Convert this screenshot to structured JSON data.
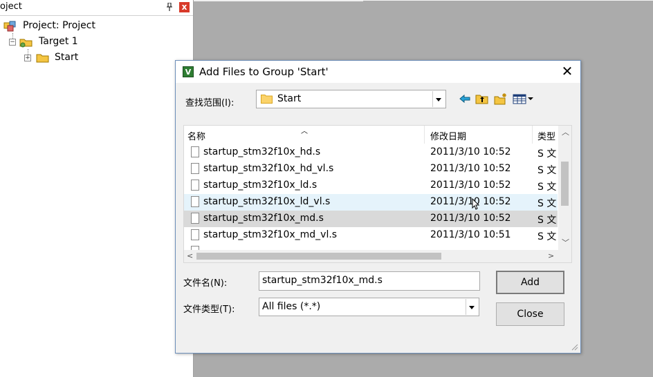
{
  "project_pane": {
    "header_title": "oject",
    "pin": "❘",
    "close": "x",
    "tree": [
      {
        "label": "Project: Project"
      },
      {
        "label": "Target 1"
      },
      {
        "label": "Start"
      }
    ]
  },
  "dialog": {
    "app_icon_letter": "V",
    "title": "Add Files to Group 'Start'",
    "close": "✕",
    "lookin_label": "查找范围(I):",
    "lookin_value": "Start",
    "columns": {
      "name": "名称",
      "date": "修改日期",
      "type": "类型"
    },
    "files": [
      {
        "name": "startup_stm32f10x_hd.s",
        "date": "2011/3/10 10:52",
        "type": "S 文"
      },
      {
        "name": "startup_stm32f10x_hd_vl.s",
        "date": "2011/3/10 10:52",
        "type": "S 文"
      },
      {
        "name": "startup_stm32f10x_ld.s",
        "date": "2011/3/10 10:52",
        "type": "S 文"
      },
      {
        "name": "startup_stm32f10x_ld_vl.s",
        "date": "2011/3/10 10:52",
        "type": "S 文"
      },
      {
        "name": "startup_stm32f10x_md.s",
        "date": "2011/3/10 10:52",
        "type": "S 文"
      },
      {
        "name": "startup_stm32f10x_md_vl.s",
        "date": "2011/3/10 10:51",
        "type": "S 文"
      }
    ],
    "filename_label": "文件名(N):",
    "filename_value": "startup_stm32f10x_md.s",
    "filetype_label": "文件类型(T):",
    "filetype_value": "All files (*.*)",
    "add_label": "Add",
    "close_label": "Close"
  },
  "colors": {
    "selected_row": "#d9d9d9",
    "hover_row": "#e5f3fb",
    "titlebar_border": "#6d8fba"
  }
}
